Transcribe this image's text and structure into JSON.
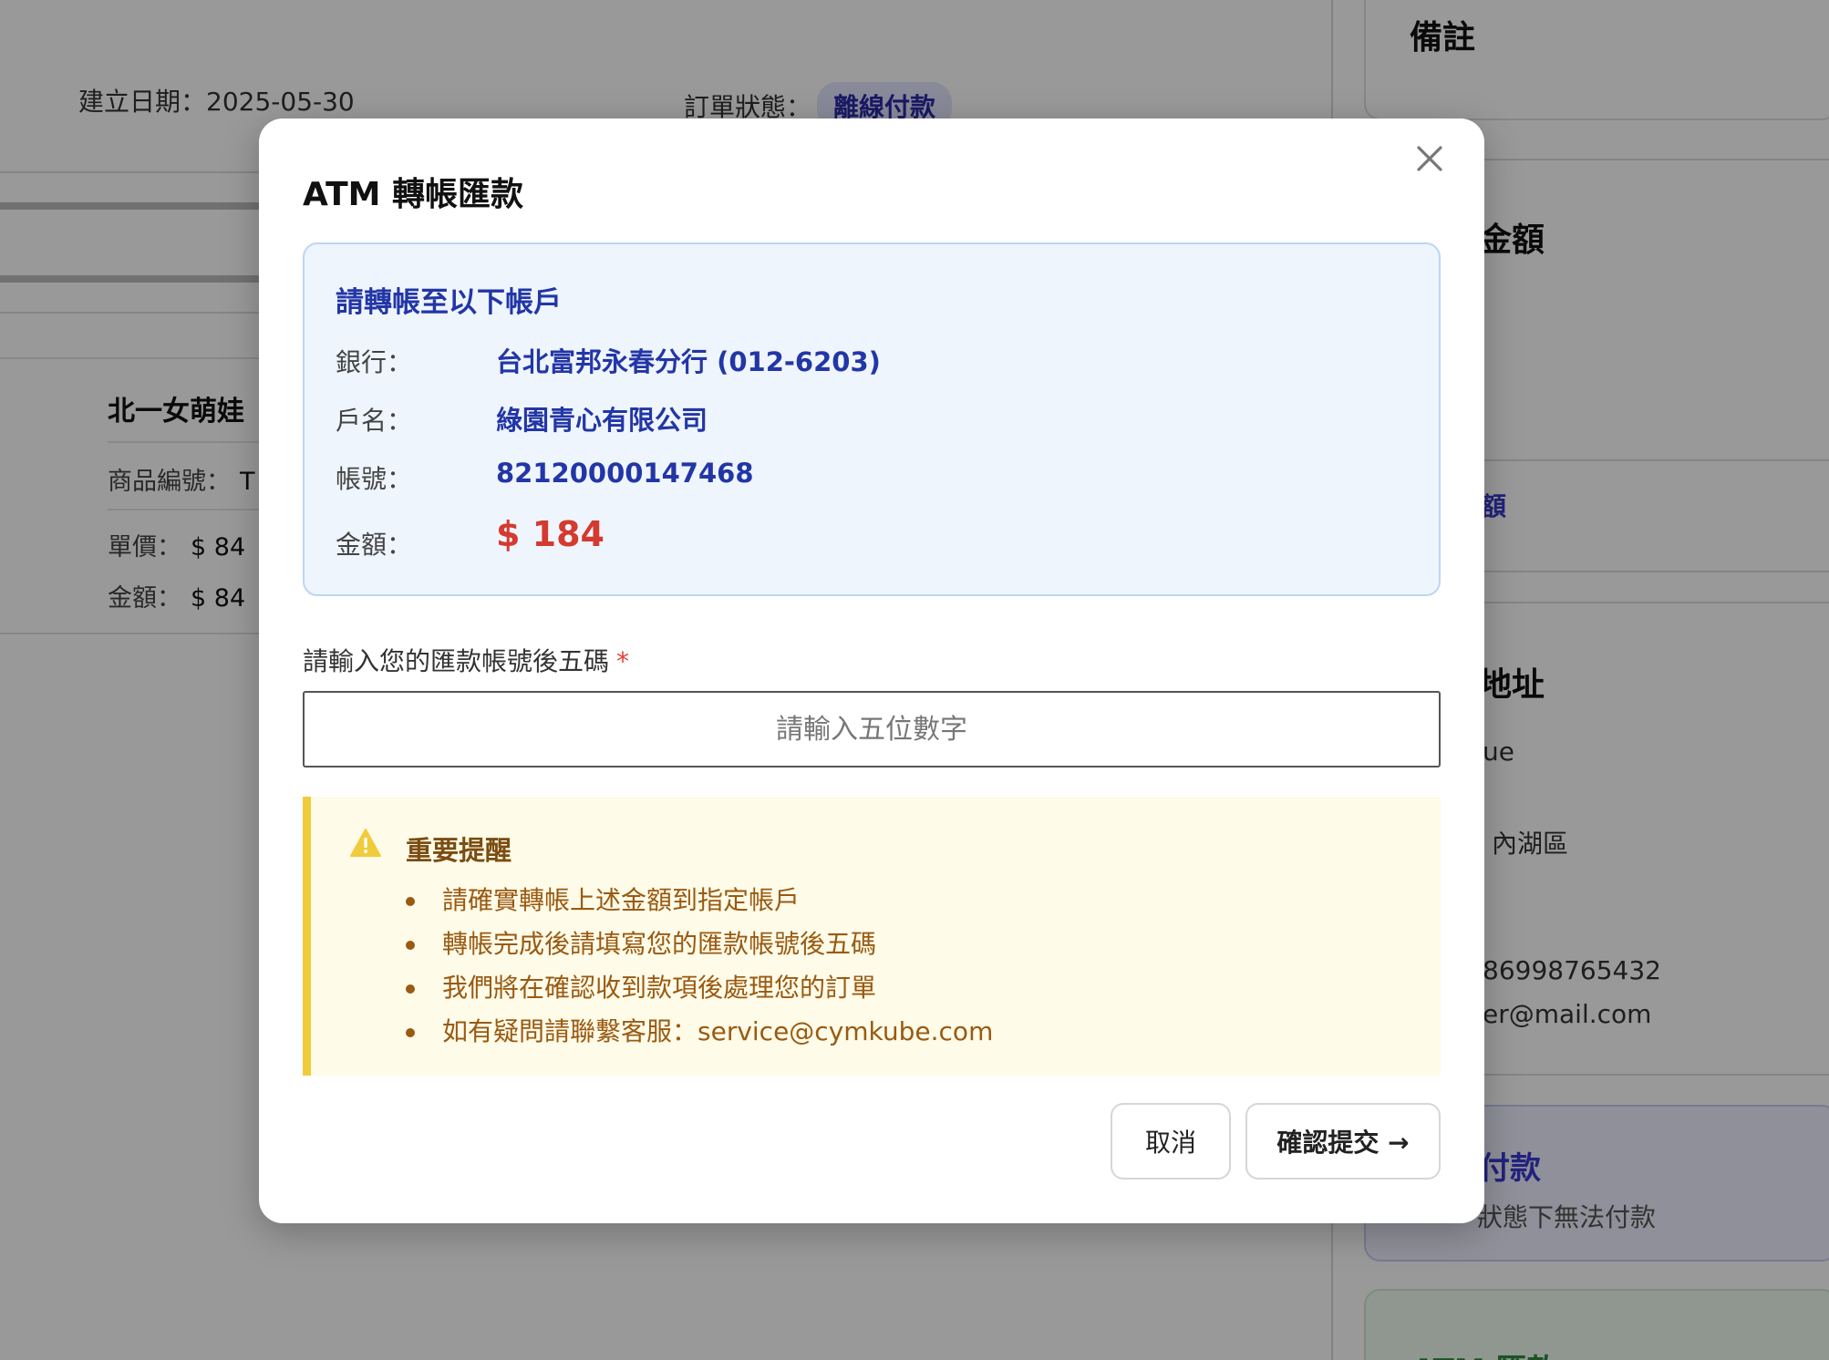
{
  "background": {
    "order": {
      "created_label": "建立日期：",
      "created_date": "2025-05-30",
      "status_label": "訂單狀態：",
      "status_value": "離線付款"
    },
    "item": {
      "name": "北一女萌娃",
      "sku_label": "商品編號：",
      "sku_value": "T",
      "unit_price_label": "單價：",
      "unit_price_value": "$ 84",
      "amount_label": "金額：",
      "amount_value": "$ 84"
    },
    "sidebar": {
      "notes_title": "備註",
      "amount_title": "金額",
      "amount_link": "額",
      "address_title": "地址",
      "address_line1": "ue",
      "address_line2": "內湖區",
      "phone": "86998765432",
      "email": "er@mail.com",
      "payment_title": "付款",
      "payment_note": "狀態下無法付款",
      "atm_title": "ATM 匯款"
    }
  },
  "modal": {
    "title": "ATM 轉帳匯款",
    "close_icon": "close-icon",
    "bank_info": {
      "heading": "請轉帳至以下帳戶",
      "bank_label": "銀行：",
      "bank_value": "台北富邦永春分行 (012-6203)",
      "holder_label": "戶名：",
      "holder_value": "綠園青心有限公司",
      "account_label": "帳號：",
      "account_value": "82120000147468",
      "amount_label": "金額：",
      "amount_value": "$ 184"
    },
    "input": {
      "label": "請輸入您的匯款帳號後五碼",
      "required_mark": "*",
      "placeholder": "請輸入五位數字",
      "value": ""
    },
    "notice": {
      "icon": "warning-icon",
      "title": "重要提醒",
      "items": [
        "請確實轉帳上述金額到指定帳戶",
        "轉帳完成後請填寫您的匯款帳號後五碼",
        "我們將在確認收到款項後處理您的訂單",
        "如有疑問請聯繫客服：service@cymkube.com"
      ]
    },
    "buttons": {
      "cancel": "取消",
      "confirm": "確認提交 →"
    }
  },
  "colors": {
    "accent_blue": "#2336a6",
    "amount_red": "#d43a2f",
    "notice_yellow": "#f2cb3c",
    "notice_text": "#9a5a12",
    "overlay": "rgba(0,0,0,0.40)"
  }
}
